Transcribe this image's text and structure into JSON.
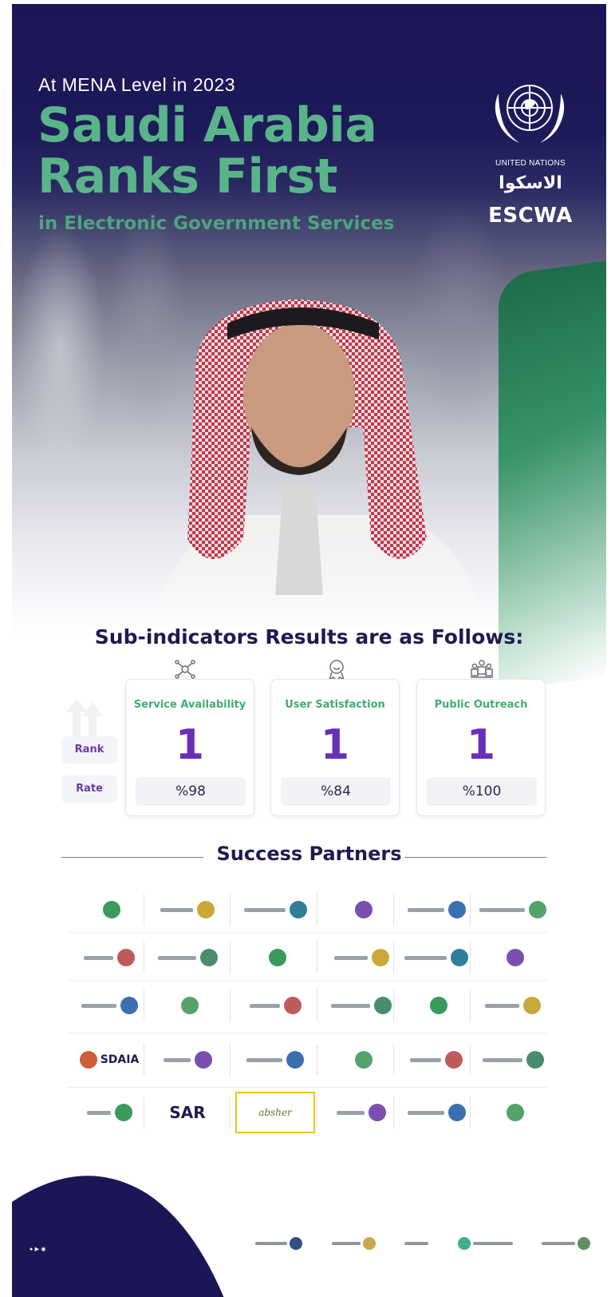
{
  "hero": {
    "tagline": "At MENA Level in 2023",
    "title_line1": "Saudi Arabia",
    "title_line2": "Ranks First",
    "subtitle": "in Electronic Government Services"
  },
  "org": {
    "un_label": "UNITED NATIONS",
    "escwa_arabic": "الاسكوا",
    "escwa_english": "ESCWA"
  },
  "indicators": {
    "heading": "Sub-indicators Results are as Follows:",
    "row_labels": {
      "rank": "Rank",
      "rate": "Rate"
    },
    "items": [
      {
        "title": "Service Availability",
        "rank": "1",
        "rate": "%98",
        "icon": "network-nodes-icon"
      },
      {
        "title": "User Satisfaction",
        "rank": "1",
        "rate": "%84",
        "icon": "satisfaction-badge-icon"
      },
      {
        "title": "Public Outreach",
        "rank": "1",
        "rate": "%100",
        "icon": "people-group-icon"
      }
    ]
  },
  "partners": {
    "heading": "Success Partners",
    "named_logos": {
      "sdaia": "SDAIA",
      "sar": "SAR",
      "ministry_script": "absher"
    }
  },
  "colors": {
    "navy": "#1b1656",
    "green_title": "#5ab48a",
    "purple_rank": "#6a2fb8",
    "card_title_green": "#3fae6e",
    "highlight_yellow": "#f1c400"
  }
}
